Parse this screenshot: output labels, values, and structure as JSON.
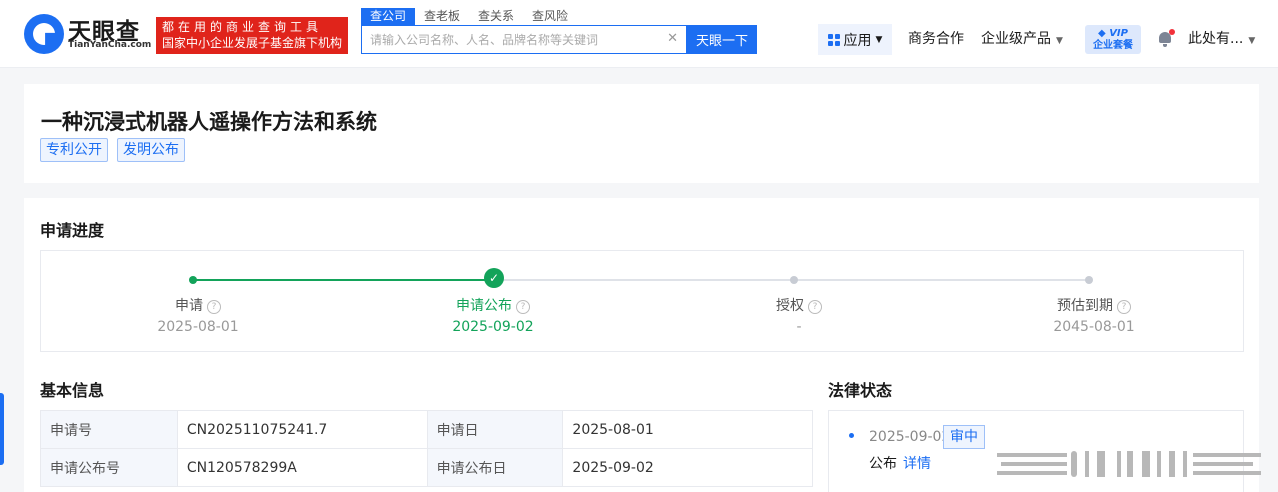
{
  "header": {
    "logo": {
      "cn": "天眼查",
      "en": "TianYanCha.com"
    },
    "slogan": {
      "line1": "都在用的商业查询工具",
      "line2": "国家中小企业发展子基金旗下机构"
    },
    "search_tabs": [
      "查公司",
      "查老板",
      "查关系",
      "查风险"
    ],
    "search": {
      "placeholder": "请输入公司名称、人名、品牌名称等关键词",
      "value": "",
      "button": "天眼一下"
    },
    "nav": {
      "app": "应用",
      "business": "商务合作",
      "enterprise": "企业级产品",
      "vip_top": "VIP",
      "vip_bottom": "企业套餐",
      "user": "此处有..."
    }
  },
  "patent": {
    "title": "一种沉浸式机器人遥操作方法和系统",
    "tags": [
      "专利公开",
      "发明公布"
    ]
  },
  "progress": {
    "title": "申请进度",
    "steps": [
      {
        "label": "申请",
        "date": "2025-08-01",
        "state": "done"
      },
      {
        "label": "申请公布",
        "date": "2025-09-02",
        "state": "current"
      },
      {
        "label": "授权",
        "date": "-",
        "state": "pending"
      },
      {
        "label": "预估到期",
        "date": "2045-08-01",
        "state": "pending"
      }
    ]
  },
  "basic_info": {
    "title": "基本信息",
    "rows": [
      [
        "申请号",
        "CN202511075241.7",
        "申请日",
        "2025-08-01"
      ],
      [
        "申请公布号",
        "CN120578299A",
        "申请公布日",
        "2025-09-02"
      ]
    ]
  },
  "legal_status": {
    "title": "法律状态",
    "date": "2025-09-02",
    "badge": "审中",
    "desc": "公布",
    "detail": "详情"
  },
  "colors": {
    "brand": "#1c6ef2",
    "green": "#13a35a",
    "red": "#e0241b"
  }
}
